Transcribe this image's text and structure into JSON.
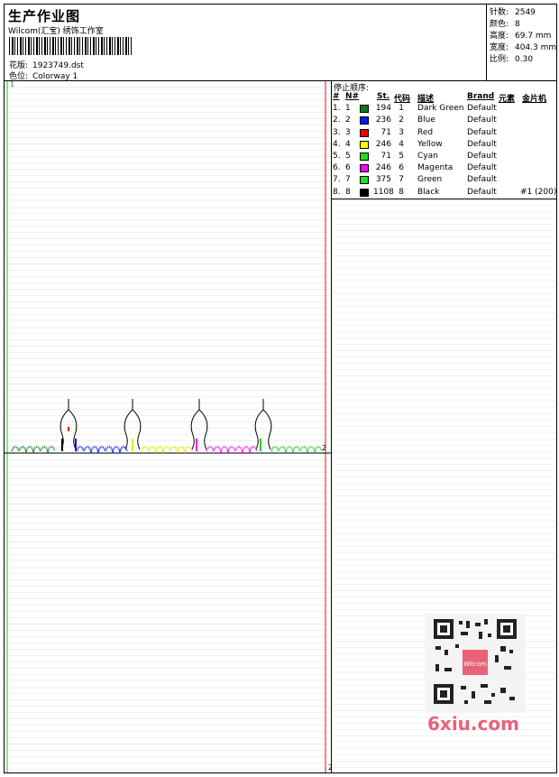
{
  "header": {
    "title": "生产作业图",
    "company": "Wilcom(汇宝) 绣饰工作室",
    "design_label": "花版:",
    "design_value": "1923749.dst",
    "colorway_label": "色位:",
    "colorway_value": "Colorway 1"
  },
  "stats": {
    "stitches_label": "针数:",
    "stitches_value": "2549",
    "colors_label": "颜色:",
    "colors_value": "8",
    "height_label": "高度:",
    "height_value": "69.7 mm",
    "width_label": "宽度:",
    "width_value": "404.3 mm",
    "scale_label": "比例:",
    "scale_value": "0.30"
  },
  "stop_sequence": {
    "title": "停止顺序:",
    "headers": {
      "hash": "#",
      "n": "N#",
      "st": "St.",
      "code": "代码",
      "desc": "描述",
      "brand": "Brand",
      "element": "元素",
      "sequin": "金片机"
    },
    "rows": [
      {
        "hash": "1.",
        "n": "1",
        "color": "#0a7a1e",
        "st": "194",
        "code": "1",
        "desc": "Dark Green",
        "brand": "Default",
        "sequin": ""
      },
      {
        "hash": "2.",
        "n": "2",
        "color": "#0019ff",
        "st": "236",
        "code": "2",
        "desc": "Blue",
        "brand": "Default",
        "sequin": ""
      },
      {
        "hash": "3.",
        "n": "3",
        "color": "#ff0000",
        "st": "71",
        "code": "3",
        "desc": "Red",
        "brand": "Default",
        "sequin": ""
      },
      {
        "hash": "4.",
        "n": "4",
        "color": "#ffff00",
        "st": "246",
        "code": "4",
        "desc": "Yellow",
        "brand": "Default",
        "sequin": ""
      },
      {
        "hash": "5.",
        "n": "5",
        "color": "#22dd22",
        "st": "71",
        "code": "5",
        "desc": "Cyan",
        "brand": "Default",
        "sequin": ""
      },
      {
        "hash": "6.",
        "n": "6",
        "color": "#ff00ff",
        "st": "246",
        "code": "6",
        "desc": "Magenta",
        "brand": "Default",
        "sequin": ""
      },
      {
        "hash": "7.",
        "n": "7",
        "color": "#22dd22",
        "st": "375",
        "code": "7",
        "desc": "Green",
        "brand": "Default",
        "sequin": ""
      },
      {
        "hash": "8.",
        "n": "8",
        "color": "#000000",
        "st": "1108",
        "code": "8",
        "desc": "Black",
        "brand": "Default",
        "sequin": "#1 (200)"
      }
    ]
  },
  "canvas": {
    "marker_start": "1",
    "marker_end_right": "2",
    "marker_bottom": "2"
  },
  "watermark": {
    "text": "6xiu.com",
    "seal": "Wilcom"
  }
}
